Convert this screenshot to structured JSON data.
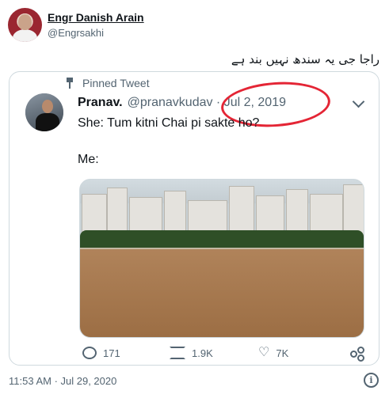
{
  "outer": {
    "name": "Engr Danish Arain",
    "handle": "@Engrsakhi",
    "text": "راجا جی یہ سندھ نہیں بند ہے",
    "timestamp": "11:53 AM · Jul 29, 2020",
    "info_icon": "info-icon"
  },
  "quoted": {
    "pinned_label": "Pinned Tweet",
    "name": "Pranav.",
    "handle": "@pranavkudav",
    "date": "Jul 2, 2019",
    "line1": "She: Tum kitni Chai pi sakte ho?",
    "line2": "Me:",
    "counts": {
      "replies": "171",
      "retweets": "1.9K",
      "likes": "7K"
    },
    "annotation_color": "#e42535"
  }
}
